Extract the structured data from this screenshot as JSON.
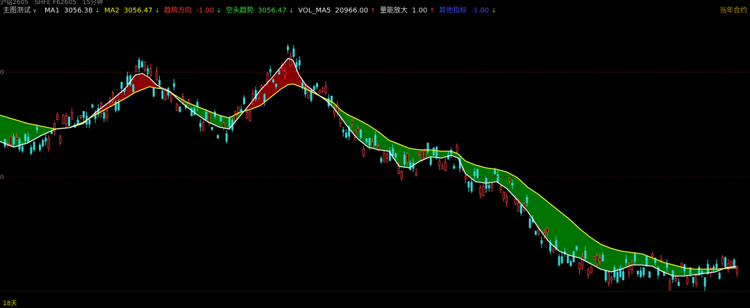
{
  "window": {
    "symbol": "沪铝2605",
    "exchange": "SHFE F62605",
    "period": "15分钟",
    "period_chevron_icon": "chevron-down-icon"
  },
  "indicator": {
    "name": "主图测试",
    "ma1_label": "MA1",
    "ma1_value": "3056.38",
    "ma1_dir": "↓",
    "ma2_label": "MA2",
    "ma2_value": "3056.47",
    "ma2_dir": "↓",
    "trend_label": "趋势方向",
    "trend_value": "-1.00",
    "trend_dir": "↓",
    "short_label": "空头趋势",
    "short_value": "3056.47",
    "short_dir": "↓",
    "vol_label": "VOL_MA5",
    "vol_value": "20966.00",
    "vol_dir": "↑",
    "vr_label": "量能放大",
    "vr_value": "1.00",
    "vr_dir": "↑",
    "extra_label": "其他指标",
    "extra_value": "-1.00",
    "extra_dir": "↓"
  },
  "contract_label": "当年合约",
  "days_label": "18天",
  "axis_marks": [
    "0",
    "0"
  ],
  "colors": {
    "background": "#000000",
    "up_candle": "#ff3b3b",
    "down_candle": "#36d6d6",
    "ma_fast": "#ffffff",
    "ma_slow": "#ffff33",
    "fill_bull": "#8b0000",
    "fill_bear": "#007400"
  },
  "chart_data": {
    "type": "candlestick",
    "title": "",
    "xlabel": "",
    "ylabel": "",
    "ma_fast_label": "MA1",
    "ma_slow_label": "MA2",
    "fast_path": [
      [
        0,
        204
      ],
      [
        20,
        212
      ],
      [
        40,
        206
      ],
      [
        60,
        195
      ],
      [
        80,
        186
      ],
      [
        100,
        184
      ],
      [
        120,
        178
      ],
      [
        140,
        160
      ],
      [
        160,
        145
      ],
      [
        180,
        128
      ],
      [
        195,
        108
      ],
      [
        205,
        106
      ],
      [
        215,
        112
      ],
      [
        225,
        122
      ],
      [
        235,
        128
      ],
      [
        245,
        132
      ],
      [
        255,
        142
      ],
      [
        270,
        155
      ],
      [
        285,
        166
      ],
      [
        300,
        176
      ],
      [
        315,
        183
      ],
      [
        330,
        186
      ],
      [
        345,
        168
      ],
      [
        360,
        150
      ],
      [
        375,
        130
      ],
      [
        390,
        114
      ],
      [
        405,
        96
      ],
      [
        415,
        84
      ],
      [
        422,
        87
      ],
      [
        430,
        107
      ],
      [
        440,
        122
      ],
      [
        450,
        130
      ],
      [
        460,
        138
      ],
      [
        470,
        145
      ],
      [
        480,
        155
      ],
      [
        490,
        168
      ],
      [
        500,
        182
      ],
      [
        515,
        200
      ],
      [
        530,
        212
      ],
      [
        545,
        216
      ],
      [
        560,
        218
      ],
      [
        575,
        240
      ],
      [
        590,
        242
      ],
      [
        605,
        232
      ],
      [
        620,
        226
      ],
      [
        635,
        228
      ],
      [
        650,
        224
      ],
      [
        660,
        228
      ],
      [
        670,
        250
      ],
      [
        685,
        262
      ],
      [
        700,
        264
      ],
      [
        715,
        262
      ],
      [
        730,
        272
      ],
      [
        745,
        288
      ],
      [
        760,
        305
      ],
      [
        775,
        328
      ],
      [
        790,
        348
      ],
      [
        805,
        362
      ],
      [
        820,
        368
      ],
      [
        835,
        372
      ],
      [
        850,
        380
      ],
      [
        865,
        388
      ],
      [
        880,
        392
      ],
      [
        895,
        388
      ],
      [
        910,
        382
      ],
      [
        925,
        382
      ],
      [
        940,
        384
      ],
      [
        955,
        392
      ],
      [
        970,
        398
      ],
      [
        985,
        398
      ],
      [
        1000,
        396
      ],
      [
        1015,
        394
      ],
      [
        1030,
        392
      ],
      [
        1045,
        386
      ],
      [
        1060,
        384
      ]
    ],
    "slow_path": [
      [
        0,
        166
      ],
      [
        20,
        172
      ],
      [
        40,
        178
      ],
      [
        60,
        182
      ],
      [
        80,
        186
      ],
      [
        100,
        184
      ],
      [
        120,
        176
      ],
      [
        140,
        164
      ],
      [
        160,
        153
      ],
      [
        180,
        142
      ],
      [
        195,
        133
      ],
      [
        205,
        129
      ],
      [
        215,
        125
      ],
      [
        225,
        127
      ],
      [
        235,
        128
      ],
      [
        245,
        133
      ],
      [
        255,
        139
      ],
      [
        270,
        148
      ],
      [
        285,
        154
      ],
      [
        300,
        160
      ],
      [
        315,
        166
      ],
      [
        330,
        170
      ],
      [
        345,
        162
      ],
      [
        360,
        158
      ],
      [
        375,
        152
      ],
      [
        390,
        140
      ],
      [
        405,
        128
      ],
      [
        415,
        122
      ],
      [
        422,
        121
      ],
      [
        430,
        124
      ],
      [
        440,
        128
      ],
      [
        450,
        133
      ],
      [
        460,
        138
      ],
      [
        470,
        143
      ],
      [
        480,
        148
      ],
      [
        490,
        158
      ],
      [
        500,
        165
      ],
      [
        515,
        172
      ],
      [
        530,
        180
      ],
      [
        545,
        190
      ],
      [
        560,
        202
      ],
      [
        575,
        208
      ],
      [
        590,
        214
      ],
      [
        605,
        216
      ],
      [
        620,
        216
      ],
      [
        635,
        218
      ],
      [
        650,
        218
      ],
      [
        660,
        222
      ],
      [
        670,
        232
      ],
      [
        685,
        238
      ],
      [
        700,
        242
      ],
      [
        715,
        244
      ],
      [
        730,
        248
      ],
      [
        745,
        256
      ],
      [
        760,
        270
      ],
      [
        775,
        280
      ],
      [
        790,
        292
      ],
      [
        805,
        304
      ],
      [
        820,
        316
      ],
      [
        835,
        330
      ],
      [
        850,
        342
      ],
      [
        865,
        352
      ],
      [
        880,
        358
      ],
      [
        895,
        362
      ],
      [
        910,
        364
      ],
      [
        925,
        366
      ],
      [
        940,
        372
      ],
      [
        955,
        378
      ],
      [
        970,
        382
      ],
      [
        985,
        386
      ],
      [
        1000,
        388
      ],
      [
        1015,
        388
      ],
      [
        1030,
        388
      ],
      [
        1045,
        387
      ],
      [
        1060,
        386
      ]
    ]
  }
}
